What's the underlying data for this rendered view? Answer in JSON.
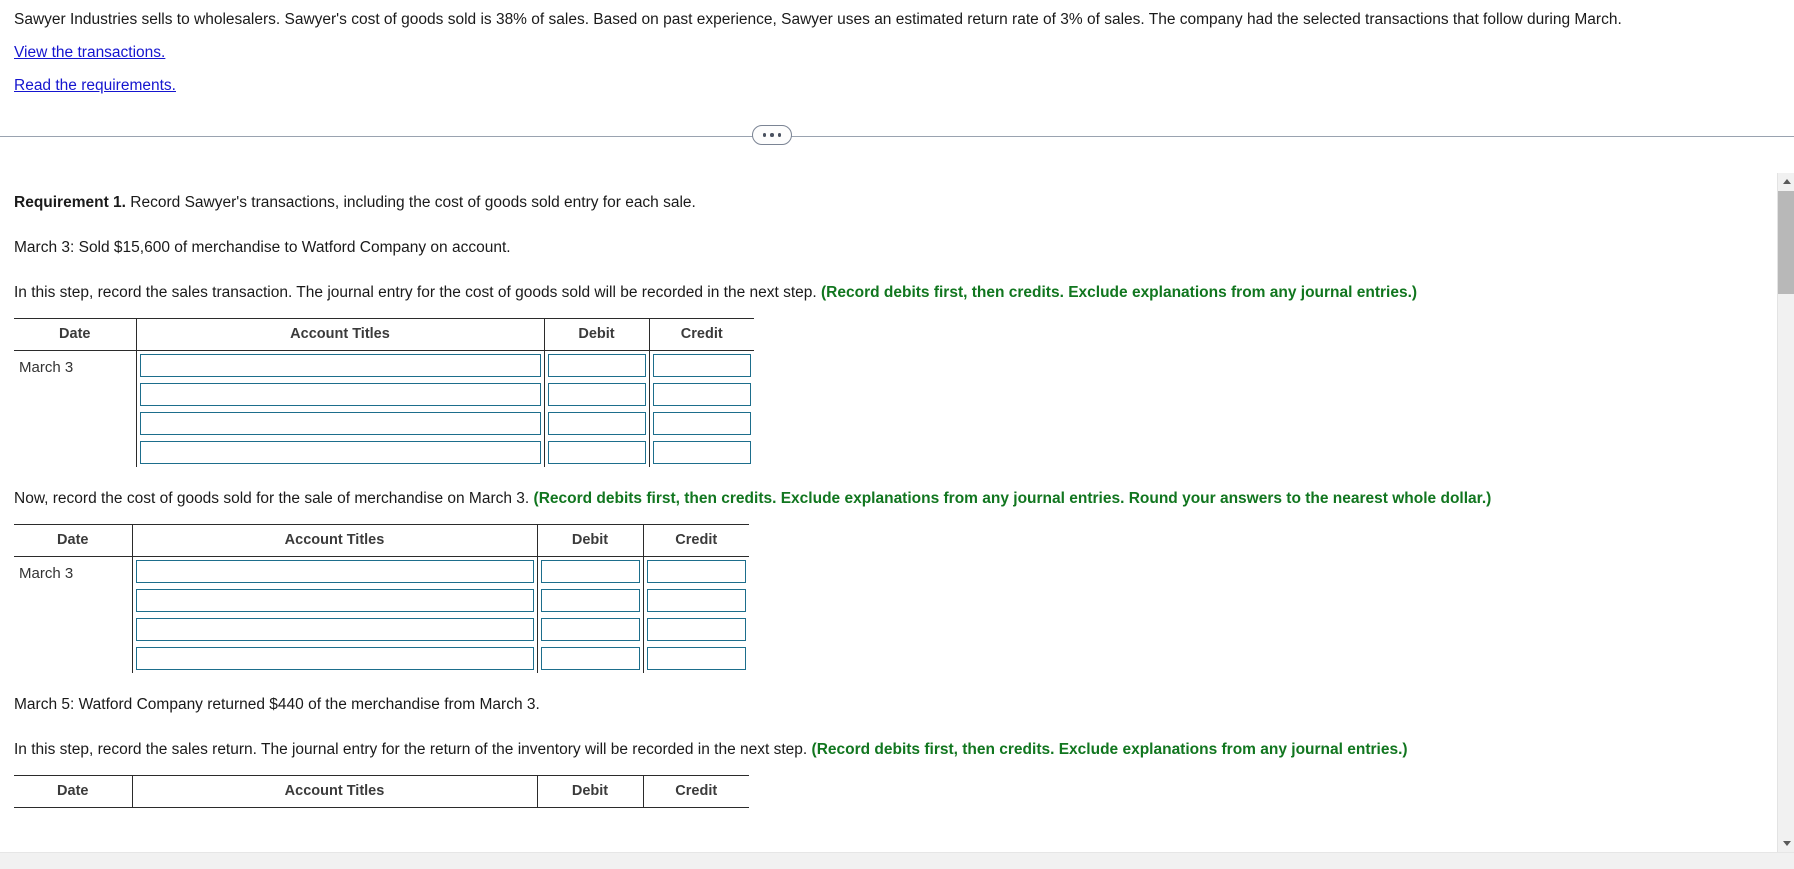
{
  "intro": {
    "paragraph": "Sawyer Industries sells to wholesalers. Sawyer's cost of goods sold is 38% of sales. Based on past experience, Sawyer uses an estimated return rate of 3% of sales. The company had the selected transactions that follow during March.",
    "link_transactions": "View the transactions.",
    "link_requirements": "Read the requirements."
  },
  "divider": {
    "ellipsis_label": "..."
  },
  "requirement": {
    "label": "Requirement 1.",
    "text": " Record Sawyer's transactions, including the cost of goods sold entry for each sale."
  },
  "sections": [
    {
      "event": "March 3: Sold $15,600 of merchandise to Watford Company on account.",
      "instruction_plain": "In this step, record the sales transaction. The journal entry for the cost of goods sold will be recorded in the next step. ",
      "instruction_green": "(Record debits first, then credits. Exclude explanations from any journal entries.)",
      "table": {
        "headers": [
          "Date",
          "Account Titles",
          "Debit",
          "Credit"
        ],
        "date_value": "March 3",
        "row_count": 4
      }
    },
    {
      "event": "",
      "instruction_plain": "Now, record the cost of goods sold for the sale of merchandise on March 3. ",
      "instruction_green": "(Record debits first, then credits. Exclude explanations from any journal entries. Round your answers to the nearest whole dollar.)",
      "table": {
        "headers": [
          "Date",
          "Account Titles",
          "Debit",
          "Credit"
        ],
        "date_value": "March 3",
        "row_count": 4
      }
    },
    {
      "event": "March 5: Watford Company returned $440 of the merchandise from March 3.",
      "instruction_plain": "In this step, record the sales return. The journal entry for the return of the inventory will be recorded in the next step. ",
      "instruction_green": "(Record debits first, then credits. Exclude explanations from any journal entries.)",
      "table": {
        "headers": [
          "Date",
          "Account Titles",
          "Debit",
          "Credit"
        ],
        "date_value": "",
        "row_count": 0
      }
    }
  ],
  "cell_placeholder": "",
  "colors": {
    "link": "#1515cf",
    "green_note": "#11761f",
    "input_border": "#1d6e8c",
    "table_rule": "#2b2b2b"
  }
}
